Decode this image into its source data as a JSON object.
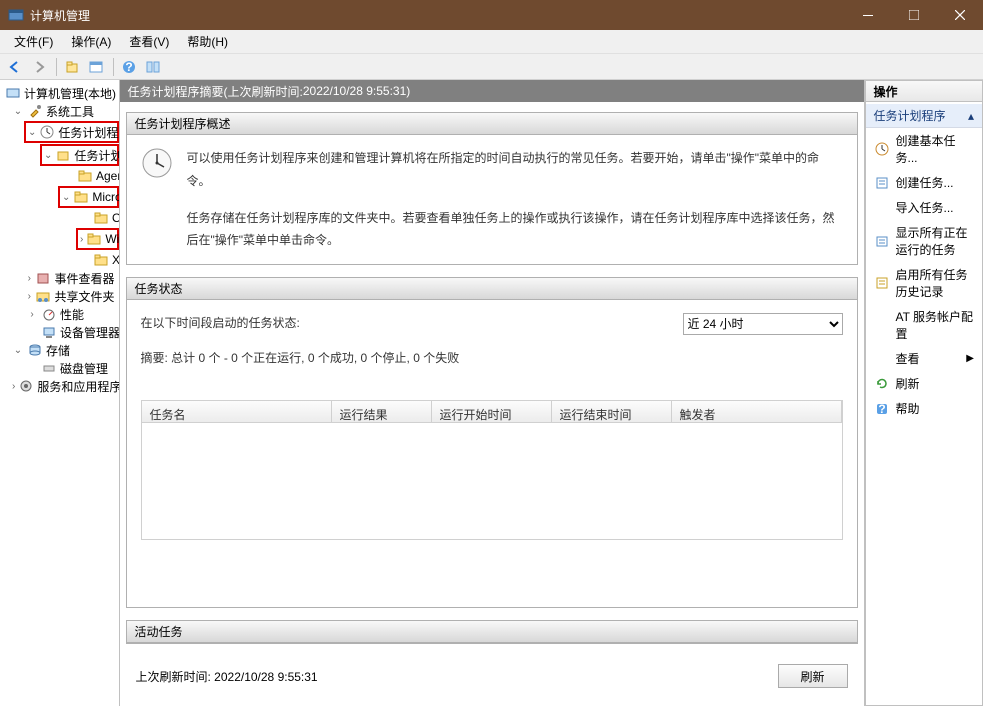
{
  "window": {
    "title": "计算机管理"
  },
  "menu": {
    "file": "文件(F)",
    "action": "操作(A)",
    "view": "查看(V)",
    "help": "帮助(H)"
  },
  "tree": {
    "root": "计算机管理(本地)",
    "systemTools": "系统工具",
    "taskScheduler": "任务计划程序",
    "taskSchedulerLib": "任务计划程序库",
    "agentActivation": "Agent Activation",
    "microsoft": "Microsoft",
    "onecore": "OneCore",
    "windows": "Windows",
    "xblgamesave": "XblGameSave",
    "eventViewer": "事件查看器",
    "sharedFolders": "共享文件夹",
    "performance": "性能",
    "deviceManager": "设备管理器",
    "storage": "存储",
    "diskManagement": "磁盘管理",
    "servicesApps": "服务和应用程序"
  },
  "center": {
    "headerPrefix": "任务计划程序摘要(上次刷新时间: ",
    "headerTime": "2022/10/28 9:55:31",
    "headerSuffix": ")",
    "overview": {
      "title": "任务计划程序概述",
      "p1": "可以使用任务计划程序来创建和管理计算机将在所指定的时间自动执行的常见任务。若要开始，请单击\"操作\"菜单中的命令。",
      "p2": "任务存储在任务计划程序库的文件夹中。若要查看单独任务上的操作或执行该操作，请在任务计划程序库中选择该任务，然后在\"操作\"菜单中单击命令。"
    },
    "status": {
      "title": "任务状态",
      "rangeLabel": "在以下时间段启动的任务状态:",
      "rangeValue": "近 24 小时",
      "summary": "摘要: 总计 0 个 - 0 个正在运行, 0 个成功, 0 个停止, 0 个失败",
      "columns": {
        "name": "任务名",
        "result": "运行结果",
        "start": "运行开始时间",
        "end": "运行结束时间",
        "trigger": "触发者"
      }
    },
    "active": {
      "title": "活动任务"
    },
    "footer": {
      "lastRefreshLabel": "上次刷新时间: ",
      "lastRefreshValue": "2022/10/28 9:55:31",
      "refreshBtn": "刷新"
    }
  },
  "actions": {
    "title": "操作",
    "group": "任务计划程序",
    "items": {
      "createBasic": "创建基本任务...",
      "createTask": "创建任务...",
      "importTask": "导入任务...",
      "showRunning": "显示所有正在运行的任务",
      "enableHistory": "启用所有任务历史记录",
      "atService": "AT 服务帐户配置",
      "view": "查看",
      "refresh": "刷新",
      "help": "帮助"
    }
  }
}
